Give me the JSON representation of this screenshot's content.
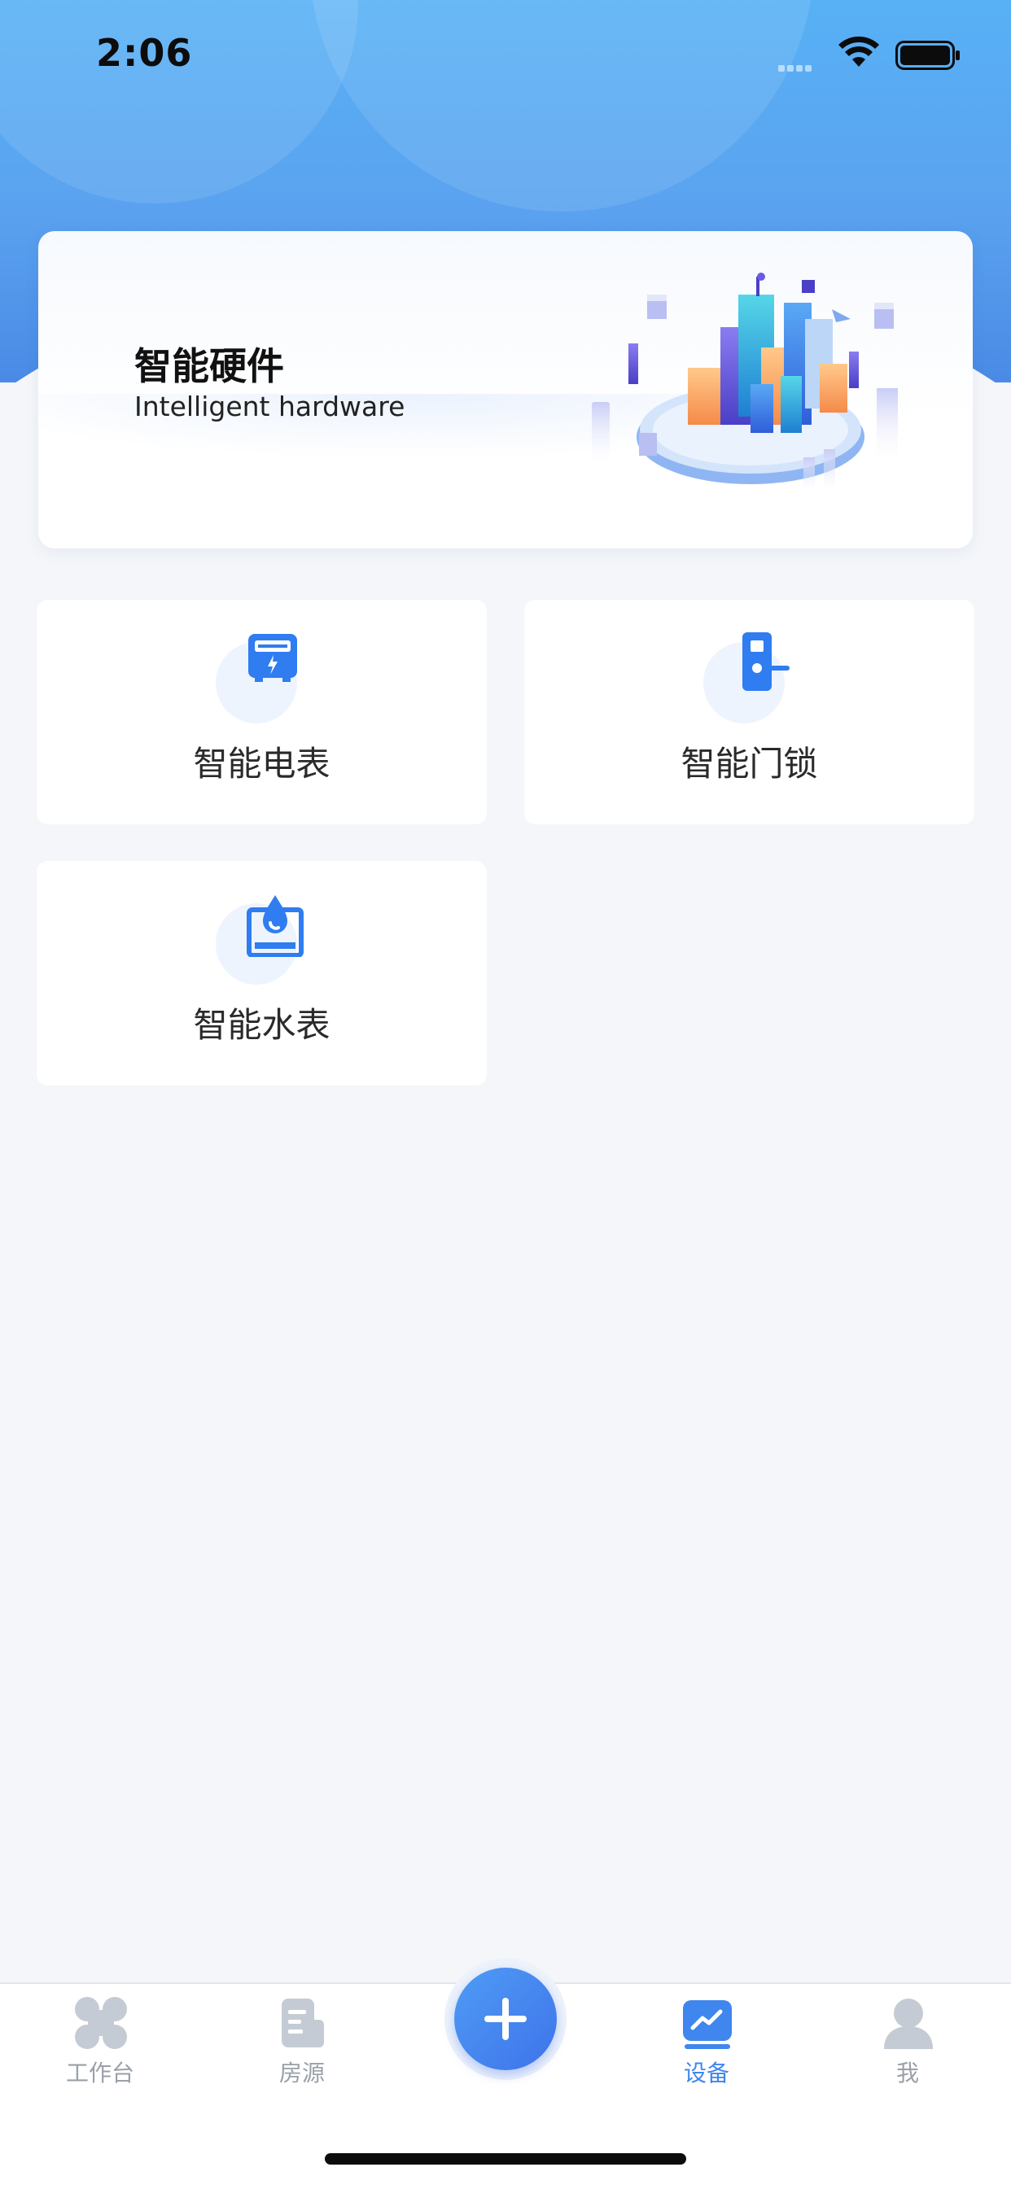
{
  "status_bar": {
    "time": "2:06"
  },
  "banner": {
    "title": "智能硬件",
    "subtitle": "Intelligent hardware"
  },
  "devices": [
    {
      "label": "智能电表",
      "icon": "electric-meter-icon"
    },
    {
      "label": "智能门锁",
      "icon": "door-lock-icon"
    },
    {
      "label": "智能水表",
      "icon": "water-meter-icon"
    }
  ],
  "tabbar": {
    "items": [
      {
        "label": "工作台",
        "icon": "workbench-icon",
        "active": false
      },
      {
        "label": "房源",
        "icon": "listing-icon",
        "active": false
      },
      {
        "label": "设备",
        "icon": "device-chart-icon",
        "active": true
      },
      {
        "label": "我",
        "icon": "user-icon",
        "active": false
      }
    ],
    "center_action": "plus-icon"
  },
  "colors": {
    "accent": "#3f86ef",
    "inactive": "#9aa0a8",
    "background": "#f4f6f9"
  }
}
